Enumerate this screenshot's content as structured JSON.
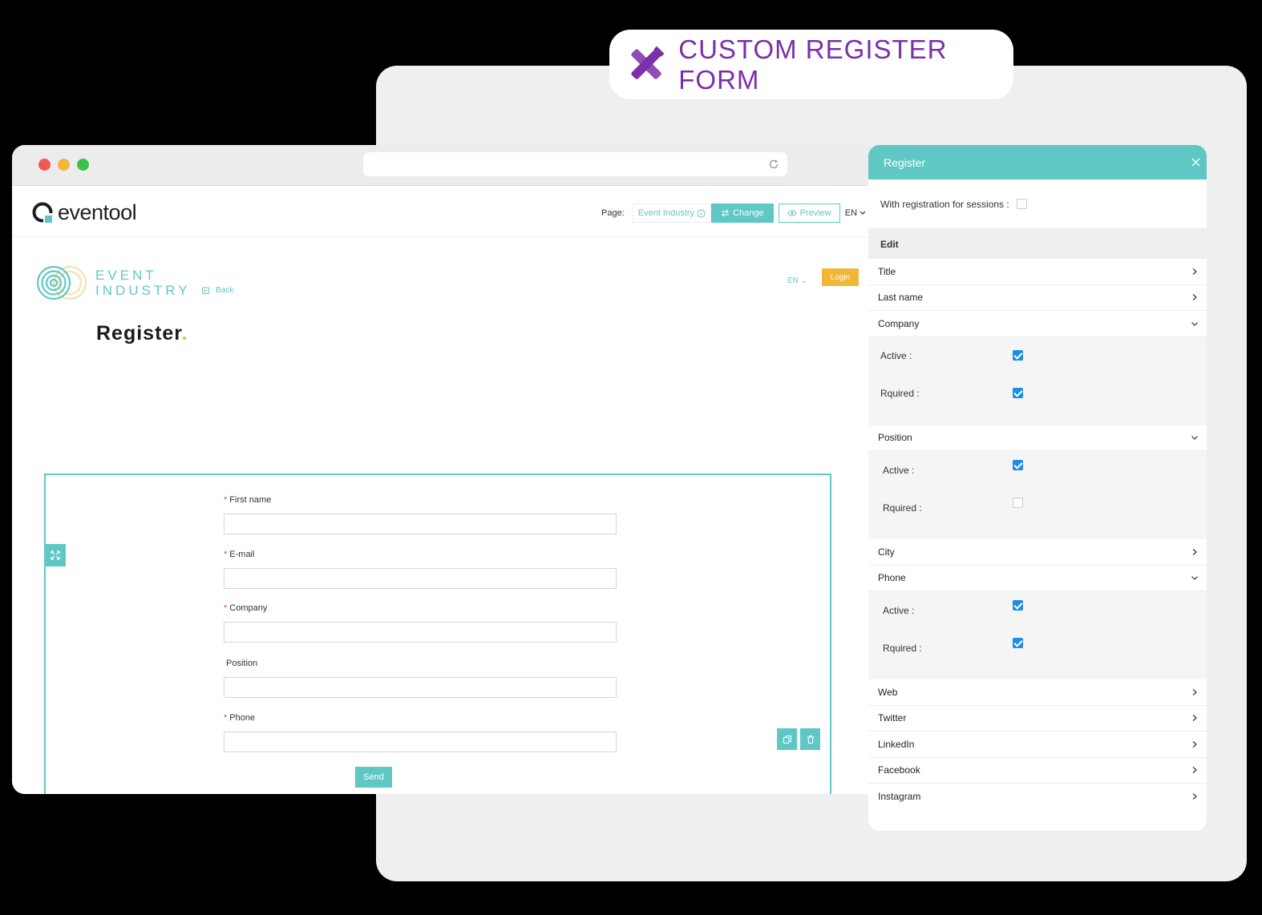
{
  "badge": {
    "text": "CUSTOM REGISTER FORM",
    "icon": "pencil-ruler-icon",
    "color": "#7b2fa8"
  },
  "app": {
    "logo_text": "eventool",
    "page_label": "Page:",
    "page_name": "Event Industry",
    "change_label": "Change",
    "preview_label": "Preview",
    "lang": "EN"
  },
  "site": {
    "logo_line1": "EVENT",
    "logo_line2": "INDUSTRY",
    "back_label": "Back",
    "lang": "EN",
    "login_label": "Login",
    "title": "Register",
    "title_dot": "."
  },
  "form": {
    "fields": [
      {
        "label": "First name",
        "required": "*"
      },
      {
        "label": "E-mail",
        "required": "*"
      },
      {
        "label": "Company",
        "required": "*"
      },
      {
        "label": "Position",
        "required": ""
      },
      {
        "label": "Phone",
        "required": "*"
      }
    ],
    "send_label": "Send"
  },
  "panel": {
    "title": "Register",
    "sessions_label": "With registration for sessions :",
    "sessions_checked": false,
    "edit_label": "Edit",
    "rows": {
      "title": "Title",
      "last_name": "Last name",
      "company": "Company",
      "position": "Position",
      "city": "City",
      "phone": "Phone",
      "web": "Web",
      "twitter": "Twitter",
      "linkedin": "LinkedIn",
      "facebook": "Facebook",
      "instagram": "Instagram"
    },
    "active_label": "Active :",
    "required_label": "Rquired :",
    "company_settings": {
      "active": true,
      "required": true
    },
    "position_settings": {
      "active": true,
      "required": false
    },
    "phone_settings": {
      "active": true,
      "required": true
    }
  },
  "colors": {
    "accent": "#5fc8c4",
    "login": "#f1b636",
    "checkbox": "#1f8ce6"
  }
}
